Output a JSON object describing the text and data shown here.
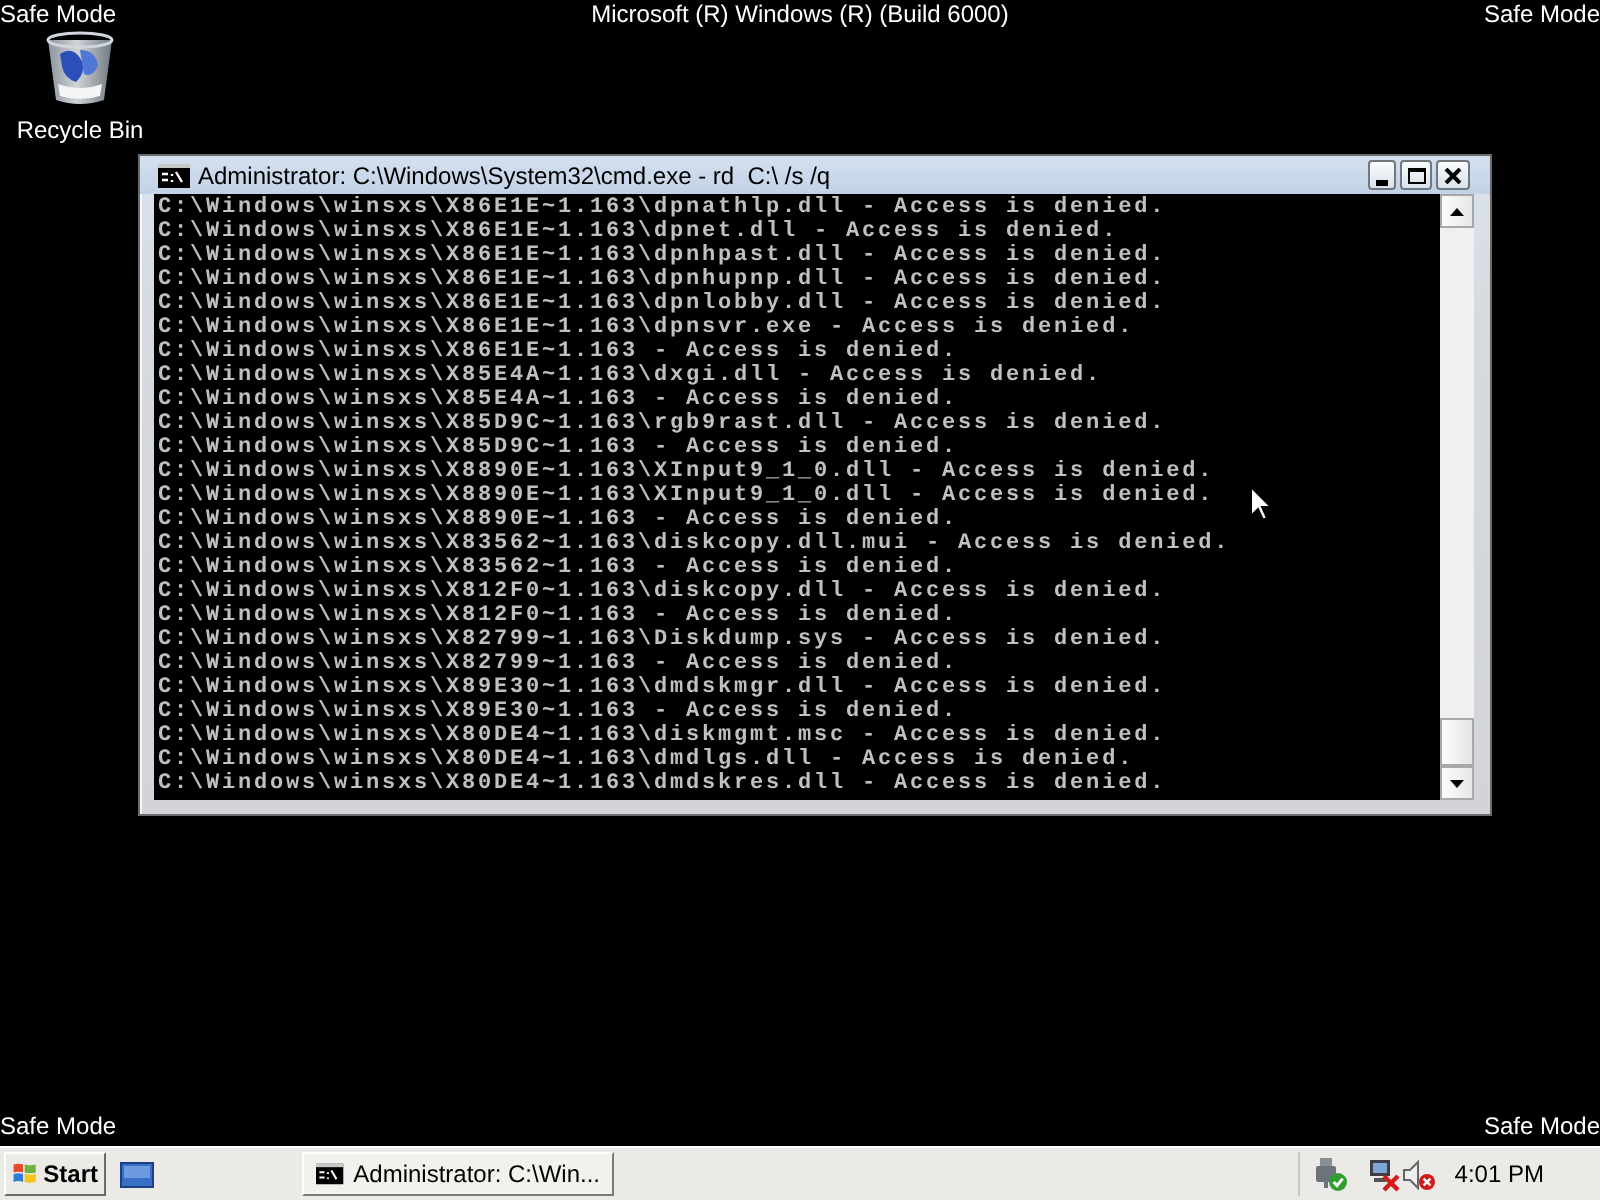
{
  "desktop": {
    "top_left": "Safe Mode",
    "banner": "Microsoft (R) Windows (R) (Build 6000)",
    "top_right": "Safe Mode",
    "icons": [
      {
        "label": "Recycle Bin"
      }
    ],
    "bottom_left": "Safe Mode",
    "bottom_right": "Safe Mode"
  },
  "window": {
    "title": "Administrator: C:\\Windows\\System32\\cmd.exe - rd  C:\\ /s /q",
    "lines": [
      "C:\\Windows\\winsxs\\X86E1E~1.163\\dpnathlp.dll - Access is denied.",
      "C:\\Windows\\winsxs\\X86E1E~1.163\\dpnet.dll - Access is denied.",
      "C:\\Windows\\winsxs\\X86E1E~1.163\\dpnhpast.dll - Access is denied.",
      "C:\\Windows\\winsxs\\X86E1E~1.163\\dpnhupnp.dll - Access is denied.",
      "C:\\Windows\\winsxs\\X86E1E~1.163\\dpnlobby.dll - Access is denied.",
      "C:\\Windows\\winsxs\\X86E1E~1.163\\dpnsvr.exe - Access is denied.",
      "C:\\Windows\\winsxs\\X86E1E~1.163 - Access is denied.",
      "C:\\Windows\\winsxs\\X85E4A~1.163\\dxgi.dll - Access is denied.",
      "C:\\Windows\\winsxs\\X85E4A~1.163 - Access is denied.",
      "C:\\Windows\\winsxs\\X85D9C~1.163\\rgb9rast.dll - Access is denied.",
      "C:\\Windows\\winsxs\\X85D9C~1.163 - Access is denied.",
      "C:\\Windows\\winsxs\\X8890E~1.163\\XInput9_1_0.dll - Access is denied.",
      "C:\\Windows\\winsxs\\X8890E~1.163\\XInput9_1_0.dll - Access is denied.",
      "C:\\Windows\\winsxs\\X8890E~1.163 - Access is denied.",
      "C:\\Windows\\winsxs\\X83562~1.163\\diskcopy.dll.mui - Access is denied.",
      "C:\\Windows\\winsxs\\X83562~1.163 - Access is denied.",
      "C:\\Windows\\winsxs\\X812F0~1.163\\diskcopy.dll - Access is denied.",
      "C:\\Windows\\winsxs\\X812F0~1.163 - Access is denied.",
      "C:\\Windows\\winsxs\\X82799~1.163\\Diskdump.sys - Access is denied.",
      "C:\\Windows\\winsxs\\X82799~1.163 - Access is denied.",
      "C:\\Windows\\winsxs\\X89E30~1.163\\dmdskmgr.dll - Access is denied.",
      "C:\\Windows\\winsxs\\X89E30~1.163 - Access is denied.",
      "C:\\Windows\\winsxs\\X80DE4~1.163\\diskmgmt.msc - Access is denied.",
      "C:\\Windows\\winsxs\\X80DE4~1.163\\dmdlgs.dll - Access is denied.",
      "C:\\Windows\\winsxs\\X80DE4~1.163\\dmdskres.dll - Access is denied."
    ]
  },
  "taskbar": {
    "start": "Start",
    "tasks": [
      {
        "label": "Administrator: C:\\Win..."
      }
    ],
    "clock": "4:01 PM"
  }
}
